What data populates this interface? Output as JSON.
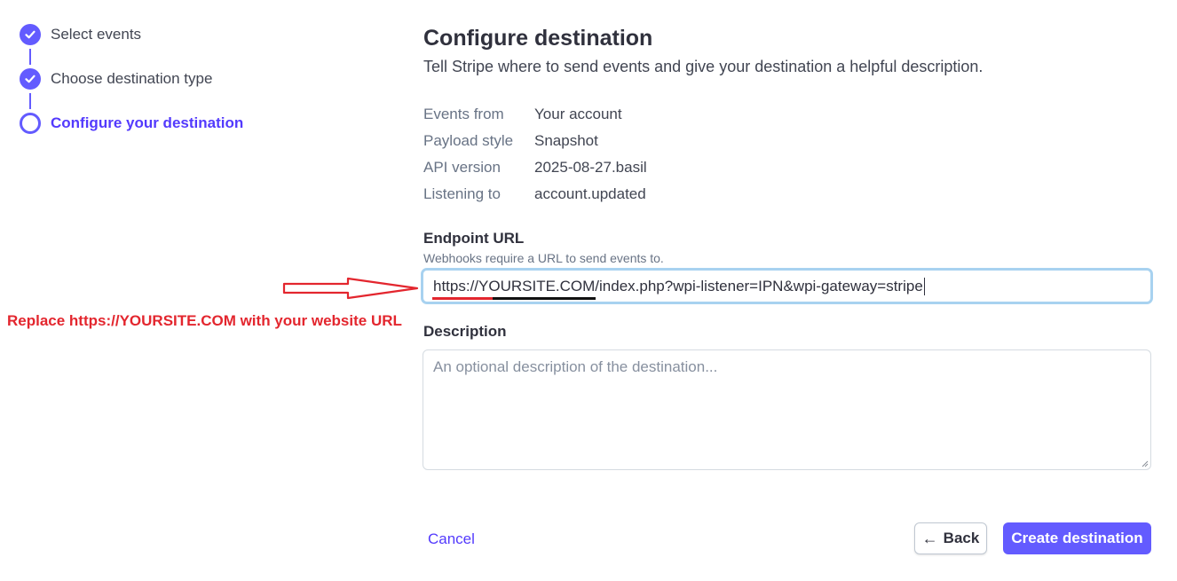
{
  "stepper": {
    "steps": [
      {
        "label": "Select events",
        "state": "done"
      },
      {
        "label": "Choose destination type",
        "state": "done"
      },
      {
        "label": "Configure your destination",
        "state": "current"
      }
    ],
    "accent_color": "#635bff"
  },
  "main": {
    "title": "Configure destination",
    "subtitle": "Tell Stripe where to send events and give your destination a helpful description.",
    "summary": [
      {
        "key": "Events from",
        "value": "Your account"
      },
      {
        "key": "Payload style",
        "value": "Snapshot"
      },
      {
        "key": "API version",
        "value": "2025-08-27.basil"
      },
      {
        "key": "Listening to",
        "value": "account.updated"
      }
    ],
    "endpoint": {
      "label": "Endpoint URL",
      "hint": "Webhooks require a URL to send events to.",
      "value": "https://YOURSITE.COM/index.php?wpi-listener=IPN&wpi-gateway=stripe"
    },
    "description": {
      "label": "Description",
      "placeholder": "An optional description of the destination..."
    }
  },
  "footer": {
    "cancel_label": "Cancel",
    "back_label": "Back",
    "create_label": "Create destination"
  },
  "annotation": {
    "text": "Replace https://YOURSITE.COM with your website URL",
    "color": "#e3262e"
  }
}
